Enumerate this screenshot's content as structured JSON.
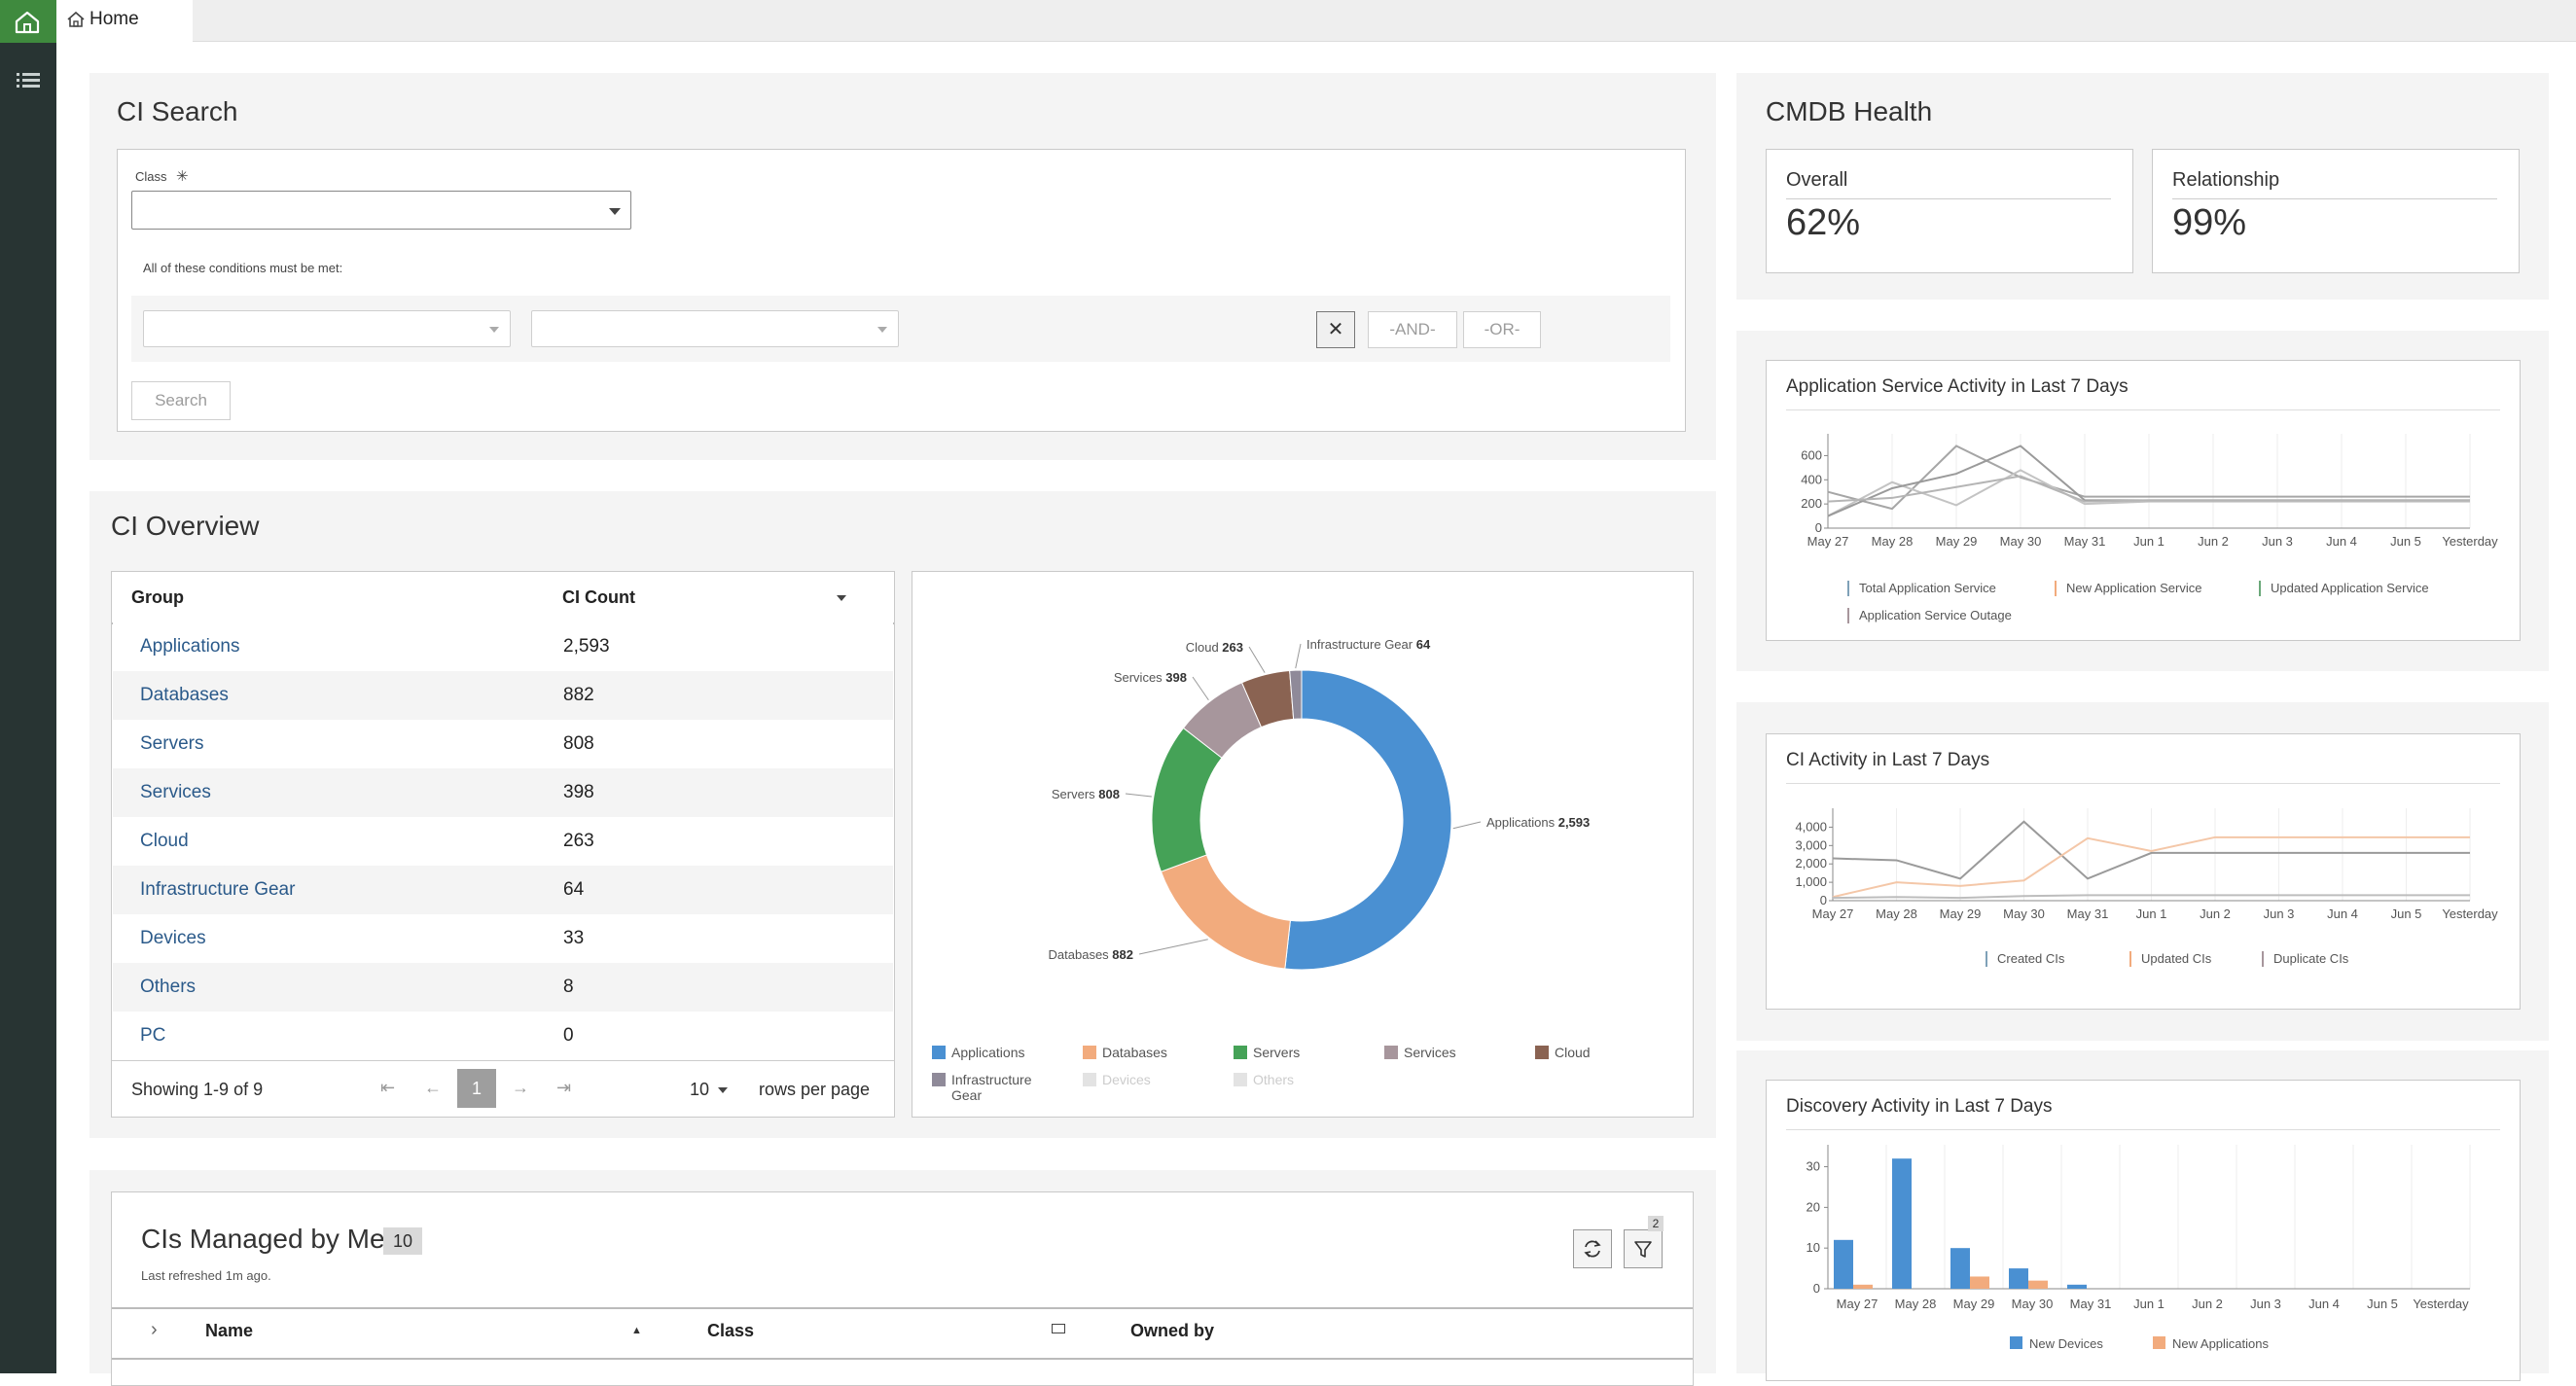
{
  "tab": {
    "label": "Home"
  },
  "ci_search": {
    "title": "CI Search",
    "class_label": "Class",
    "required_mark": "✳",
    "class_value": "",
    "conditions_text": "All of these conditions must be met:",
    "clear_symbol": "✕",
    "and_label": "-AND-",
    "or_label": "-OR-",
    "search_label": "Search"
  },
  "ci_overview": {
    "title": "CI Overview",
    "columns": [
      "Group",
      "CI Count"
    ],
    "rows": [
      {
        "group": "Applications",
        "count": "2,593"
      },
      {
        "group": "Databases",
        "count": "882"
      },
      {
        "group": "Servers",
        "count": "808"
      },
      {
        "group": "Services",
        "count": "398"
      },
      {
        "group": "Cloud",
        "count": "263"
      },
      {
        "group": "Infrastructure Gear",
        "count": "64"
      },
      {
        "group": "Devices",
        "count": "33"
      },
      {
        "group": "Others",
        "count": "8"
      },
      {
        "group": "PC",
        "count": "0"
      }
    ],
    "pagination": {
      "showing": "Showing 1-9 of 9",
      "page": "1",
      "rows_per_page_value": "10",
      "rows_per_page_label": "rows per page"
    }
  },
  "donut": {
    "chart_data": {
      "type": "pie",
      "donut": true,
      "categories": [
        "Applications",
        "Databases",
        "Servers",
        "Services",
        "Cloud",
        "Infrastructure Gear"
      ],
      "values": [
        2593,
        882,
        808,
        398,
        263,
        64
      ],
      "value_labels": [
        "2,593",
        "882",
        "808",
        "398",
        "263",
        "64"
      ],
      "colors": [
        "#4a90d2",
        "#f2ab7d",
        "#45a257",
        "#a7969c",
        "#8a6352",
        "#8f8a99"
      ],
      "legend": [
        {
          "label": "Applications",
          "color": "#4a90d2",
          "active": true
        },
        {
          "label": "Databases",
          "color": "#f2ab7d",
          "active": true
        },
        {
          "label": "Servers",
          "color": "#45a257",
          "active": true
        },
        {
          "label": "Services",
          "color": "#a7969c",
          "active": true
        },
        {
          "label": "Cloud",
          "color": "#8a6352",
          "active": true
        },
        {
          "label": "Infrastructure Gear",
          "color": "#8f8a99",
          "active": true
        },
        {
          "label": "Devices",
          "color": "#e3e3e3",
          "active": false
        },
        {
          "label": "Others",
          "color": "#e3e3e3",
          "active": false
        }
      ],
      "legend_position": "bottom"
    }
  },
  "managed": {
    "title": "CIs Managed by Me",
    "count": "10",
    "refreshed": "Last refreshed 1m ago.",
    "filter_count": "2",
    "columns": [
      "Name",
      "Class",
      "Owned by"
    ]
  },
  "cmdb_health": {
    "title": "CMDB Health",
    "overall_label": "Overall",
    "overall_value": "62%",
    "relationship_label": "Relationship",
    "relationship_value": "99%"
  },
  "app_activity": {
    "chart_data": {
      "type": "line",
      "title": "Application Service Activity in Last 7 Days",
      "x": [
        "May 27",
        "May 28",
        "May 29",
        "May 30",
        "May 31",
        "Jun 1",
        "Jun 2",
        "Jun 3",
        "Jun 4",
        "Jun 5",
        "Yesterday"
      ],
      "yticks": [
        0,
        200,
        400,
        600
      ],
      "ylim": [
        0,
        700
      ],
      "series": [
        {
          "name": "Total Application Service",
          "color": "#a6a6a6",
          "values": [
            300,
            160,
            680,
            420,
            260,
            260,
            260,
            260,
            260,
            260,
            260
          ]
        },
        {
          "name": "New Application Service",
          "color": "#c3c3c3",
          "values": [
            100,
            380,
            190,
            480,
            200,
            220,
            220,
            220,
            220,
            220,
            220
          ]
        },
        {
          "name": "Updated Application Service",
          "color": "#9a9a9a",
          "values": [
            100,
            330,
            450,
            680,
            230,
            230,
            230,
            230,
            230,
            230,
            230
          ]
        },
        {
          "name": "Application Service Outage",
          "color": "#b5b5b5",
          "values": [
            220,
            250,
            340,
            430,
            220,
            230,
            230,
            230,
            230,
            230,
            230
          ]
        }
      ],
      "legend_colors": [
        "#7fa1b8",
        "#f2ab7d",
        "#6aa879",
        "#a7969c"
      ],
      "legend_position": "bottom"
    }
  },
  "ci_activity": {
    "chart_data": {
      "type": "line",
      "title": "CI Activity in Last 7 Days",
      "x": [
        "May 27",
        "May 28",
        "May 29",
        "May 30",
        "May 31",
        "Jun 1",
        "Jun 2",
        "Jun 3",
        "Jun 4",
        "Jun 5",
        "Yesterday"
      ],
      "yticks": [
        0,
        1000,
        2000,
        3000,
        4000
      ],
      "ytick_labels": [
        "0",
        "1,000",
        "2,000",
        "3,000",
        "4,000"
      ],
      "ylim": [
        0,
        4500
      ],
      "series": [
        {
          "name": "Created CIs",
          "color": "#9a9a9a",
          "values": [
            2300,
            2200,
            1200,
            4300,
            1200,
            2600,
            2600,
            2600,
            2600,
            2600,
            2600
          ]
        },
        {
          "name": "Updated CIs",
          "color": "#f4c7a8",
          "values": [
            200,
            1000,
            800,
            1100,
            3400,
            2700,
            3450,
            3450,
            3450,
            3450,
            3450
          ]
        },
        {
          "name": "Duplicate CIs",
          "color": "#bdbdbd",
          "values": [
            150,
            200,
            150,
            250,
            300,
            300,
            300,
            300,
            300,
            300,
            300
          ]
        }
      ],
      "legend_colors": [
        "#7fa1b8",
        "#f2ab7d",
        "#a7969c"
      ],
      "legend_position": "bottom"
    }
  },
  "discovery": {
    "chart_data": {
      "type": "bar",
      "title": "Discovery Activity in Last 7 Days",
      "categories": [
        "May 27",
        "May 28",
        "May 29",
        "May 30",
        "May 31",
        "Jun 1",
        "Jun 2",
        "Jun 3",
        "Jun 4",
        "Jun 5",
        "Yesterday"
      ],
      "yticks": [
        0,
        10,
        20,
        30
      ],
      "ylim": [
        0,
        33
      ],
      "series": [
        {
          "name": "New Devices",
          "color": "#4a90d2",
          "values": [
            12,
            32,
            10,
            5,
            1,
            0,
            0,
            0,
            0,
            0,
            0
          ]
        },
        {
          "name": "New Applications",
          "color": "#f2ab7d",
          "values": [
            1,
            0,
            3,
            2,
            0,
            0,
            0,
            0,
            0,
            0,
            0
          ]
        }
      ],
      "legend_position": "bottom"
    }
  }
}
